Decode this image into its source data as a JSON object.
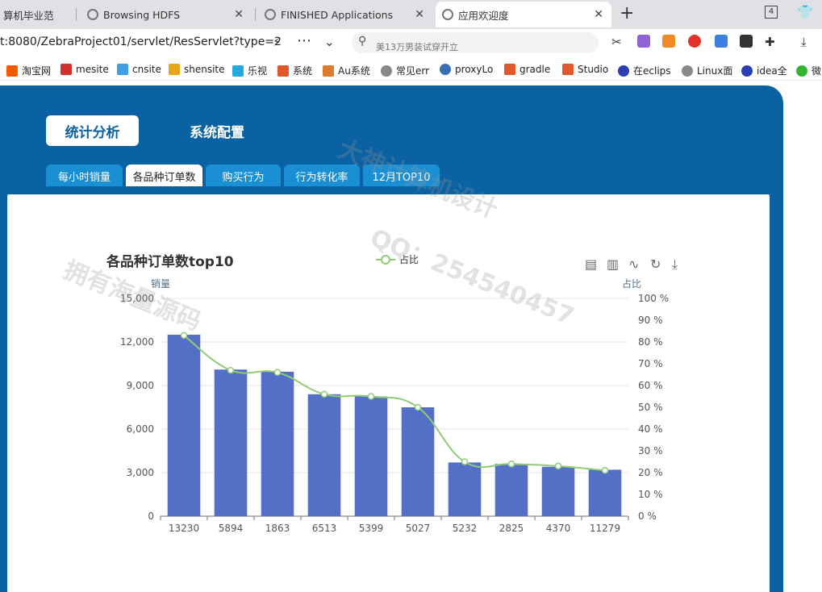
{
  "browser": {
    "tabs": [
      {
        "title": "算机毕业范",
        "active": false
      },
      {
        "title": "Browsing HDFS",
        "active": false
      },
      {
        "title": "FINISHED Applications",
        "active": false
      },
      {
        "title": "应用欢迎度",
        "active": true
      }
    ],
    "tab_count": "4",
    "url": "t:8080/ZebraProject01/servlet/ResServlet?type=2",
    "search_placeholder": "美13万男装试穿开立",
    "bookmarks": [
      {
        "label": "淘宝网",
        "color": "#ff5a00"
      },
      {
        "label": "mesite",
        "color": "#d0312d"
      },
      {
        "label": "cnsite",
        "color": "#3c9ee5"
      },
      {
        "label": "shensite",
        "color": "#e7a614"
      },
      {
        "label": "乐视",
        "color": "#2aa9e0"
      },
      {
        "label": "系统",
        "color": "#e2562b"
      },
      {
        "label": "Au系统",
        "color": "#e07b2b"
      },
      {
        "label": "常见err",
        "color": "#888888"
      },
      {
        "label": "proxyLo",
        "color": "#3a6fb8"
      },
      {
        "label": "gradle",
        "color": "#e2562b"
      },
      {
        "label": "Studio",
        "color": "#e2562b"
      },
      {
        "label": "在eclips",
        "color": "#2c3fb0"
      },
      {
        "label": "Linux面",
        "color": "#888888"
      },
      {
        "label": "idea全",
        "color": "#2c3fb0"
      },
      {
        "label": "微",
        "color": "#2fb52f"
      }
    ]
  },
  "nav": {
    "main_tabs": [
      "统计分析",
      "系统配置"
    ],
    "sub_tabs": [
      "每小时销量",
      "各品种订单数",
      "购买行为",
      "行为转化率",
      "12月TOP10"
    ]
  },
  "watermarks": [
    "大神计算机设计",
    "QQ：254540457",
    "拥有海量源码"
  ],
  "chart_data": {
    "type": "bar",
    "title": "各品种订单数top10",
    "ylabel": "销量",
    "y2label": "占比",
    "legend": "占比",
    "legend_position": "top-center",
    "categories": [
      "13230",
      "5894",
      "1863",
      "6513",
      "5399",
      "5027",
      "5232",
      "2825",
      "4370",
      "11279"
    ],
    "series": [
      {
        "type": "bar",
        "values": [
          12500,
          10100,
          9950,
          8400,
          8250,
          7500,
          3700,
          3600,
          3400,
          3200
        ],
        "color": "#5470c6"
      },
      {
        "name": "占比",
        "type": "line",
        "smooth": true,
        "values": [
          83,
          67,
          66,
          56,
          55,
          50,
          25,
          24,
          23,
          21
        ],
        "color": "#91cc75"
      }
    ],
    "ylim": [
      0,
      15000
    ],
    "yticks": [
      "0",
      "3,000",
      "6,000",
      "9,000",
      "12,000",
      "15,000"
    ],
    "y2lim": [
      0,
      100
    ],
    "y2ticks": [
      "0 %",
      "10 %",
      "20 %",
      "30 %",
      "40 %",
      "50 %",
      "60 %",
      "70 %",
      "80 %",
      "90 %",
      "100 %"
    ],
    "grid": true
  }
}
